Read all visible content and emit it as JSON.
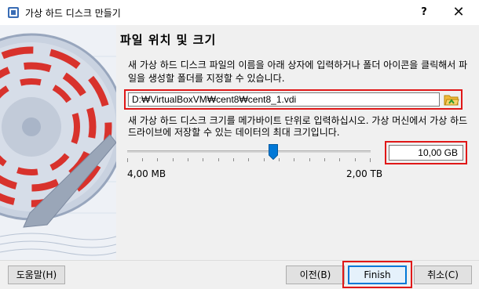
{
  "window": {
    "title": "가상 하드 디스크 만들기",
    "help_glyph": "?",
    "close_glyph": "✕",
    "icon": "virtualbox-icon"
  },
  "page": {
    "title": "파일 위치 및 크기",
    "location_description": "새 가상 하드 디스크 파일의 이름을 아래 상자에 입력하거나 폴더 아이콘을 클릭해서 파일을 생성할 폴더를 지정할 수 있습니다.",
    "file_path": "D:₩VirtualBoxVM₩cent8₩cent8_1.vdi",
    "folder_icon": "folder-open-icon",
    "size_description": "새 가상 하드 디스크 크기를 메가바이트 단위로 입력하십시오. 가상 머신에서 가상 하드 드라이브에 저장할 수 있는 데이터의 최대 크기입니다.",
    "size_value": "10,00 GB",
    "slider_min_label": "4,00 MB",
    "slider_max_label": "2,00 TB",
    "slider_position_fraction": 0.6
  },
  "footer": {
    "help_label": "도움말(H)",
    "back_label": "이전(B)",
    "finish_label": "Finish",
    "cancel_label": "취소(C)"
  },
  "colors": {
    "highlight": "#e01818",
    "art_red": "#d8322c",
    "accent_blue": "#0078d7"
  }
}
